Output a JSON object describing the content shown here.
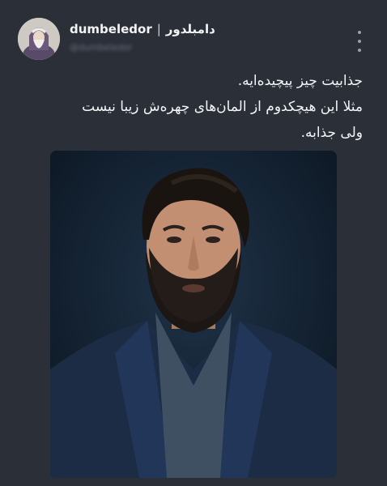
{
  "post": {
    "author_name_latin": "dumbeledor",
    "separator": "|",
    "author_name_fa": "دامبلدور",
    "handle": "@dumbeledor",
    "text_lines": [
      "جذابیت چیز پیچیده‌ایه.",
      "مثلا این هیچکدوم از المان‌های چهره‌ش زیبا نیست",
      "ولی جذابه."
    ]
  },
  "icons": {
    "more": "more-vertical-icon"
  },
  "colors": {
    "background": "#2b2f38",
    "text": "#f4f5f7",
    "muted": "#6c7280",
    "photo_background": "#141f2d"
  }
}
